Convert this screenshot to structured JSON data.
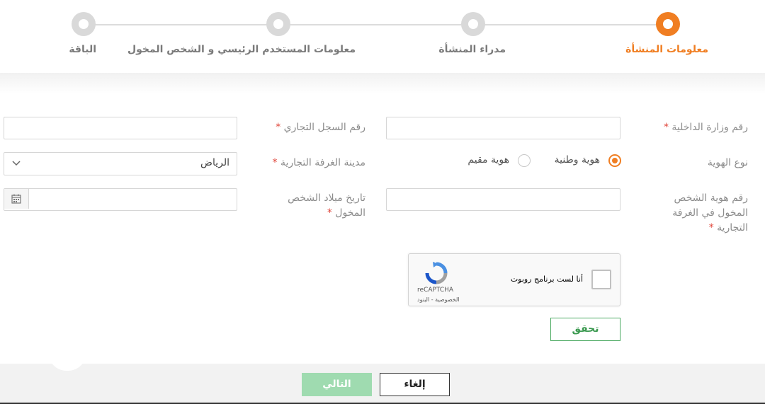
{
  "stepper": {
    "steps": [
      {
        "label": "معلومات المنشأة",
        "active": true
      },
      {
        "label": "مدراء المنشأة",
        "active": false
      },
      {
        "label": "معلومات المستخدم الرئيسي و الشخص المخول",
        "active": false
      },
      {
        "label": "الباقة",
        "active": false
      }
    ]
  },
  "form": {
    "required_mark": "*",
    "moi_number": {
      "label": "رقم وزارة الداخلية",
      "value": ""
    },
    "cr_number": {
      "label": "رقم السجل التجاري",
      "value": ""
    },
    "id_type": {
      "label": "نوع الهوية",
      "options": [
        {
          "label": "هوية وطنية",
          "selected": true
        },
        {
          "label": "هوية مقيم",
          "selected": false
        }
      ]
    },
    "chamber_city": {
      "label": "مدينة الغرفة التجارية",
      "value": "الرياض"
    },
    "authorized_id": {
      "label": "رقم هوية الشخص المخول في الغرفة التجارية",
      "value": ""
    },
    "authorized_dob": {
      "label": "تاريخ ميلاد الشخص المخول",
      "value": ""
    }
  },
  "captcha": {
    "text": "أنا لست برنامج روبوت",
    "brand": "reCAPTCHA",
    "links": "الخصوصية - البنود"
  },
  "buttons": {
    "verify": "تحقق",
    "cancel": "إلغاء",
    "next": "التالي"
  },
  "colors": {
    "accent": "#f07e22",
    "green": "#3d9a52",
    "next_disabled": "#9fdbb0"
  }
}
